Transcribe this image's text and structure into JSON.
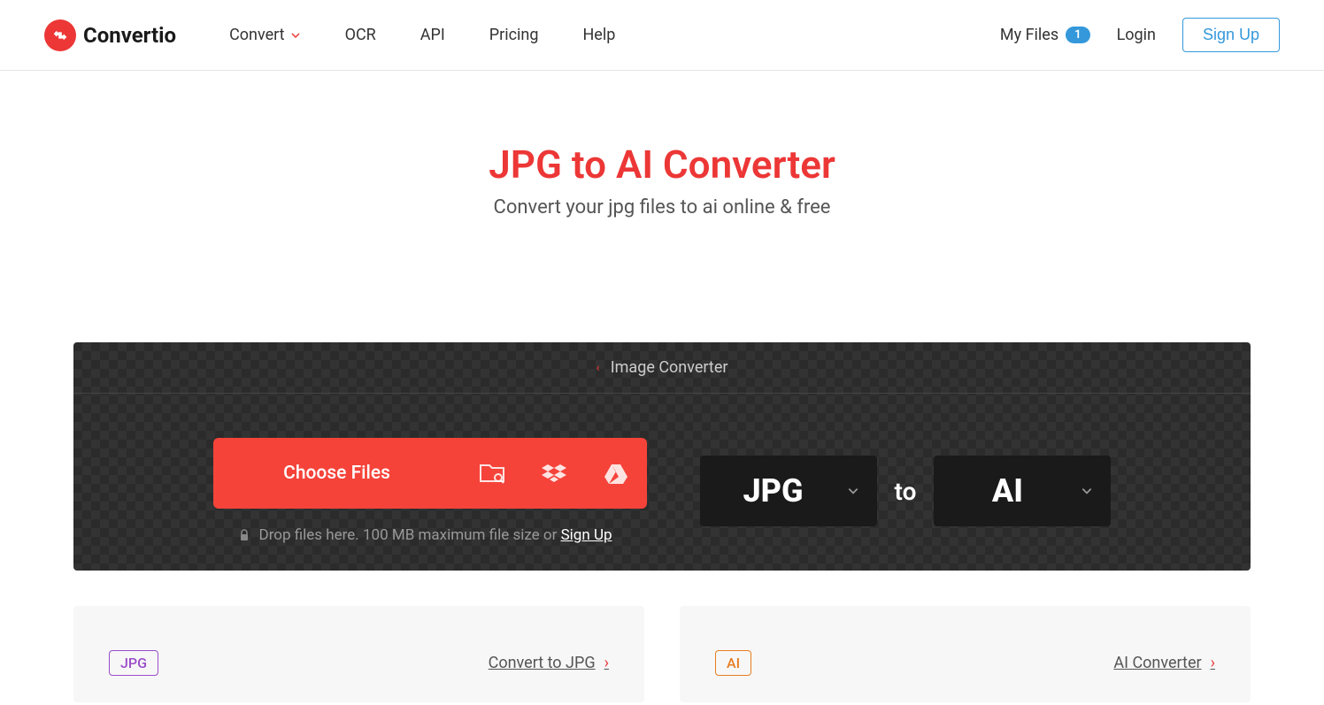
{
  "brand": "Convertio",
  "nav": {
    "convert": "Convert",
    "ocr": "OCR",
    "api": "API",
    "pricing": "Pricing",
    "help": "Help"
  },
  "header_right": {
    "my_files": "My Files",
    "file_count": "1",
    "login": "Login",
    "signup": "Sign Up"
  },
  "hero": {
    "title": "JPG to AI Converter",
    "subtitle": "Convert your jpg files to ai online & free"
  },
  "breadcrumb": "Image Converter",
  "upload": {
    "choose_label": "Choose Files",
    "drop_text": "Drop files here. 100 MB maximum file size or ",
    "signup_link": "Sign Up",
    "from_format": "JPG",
    "to_label": "to",
    "to_format": "AI"
  },
  "cards": {
    "left": {
      "badge": "JPG",
      "link": "Convert to JPG"
    },
    "right": {
      "badge": "AI",
      "link": "AI Converter"
    }
  }
}
